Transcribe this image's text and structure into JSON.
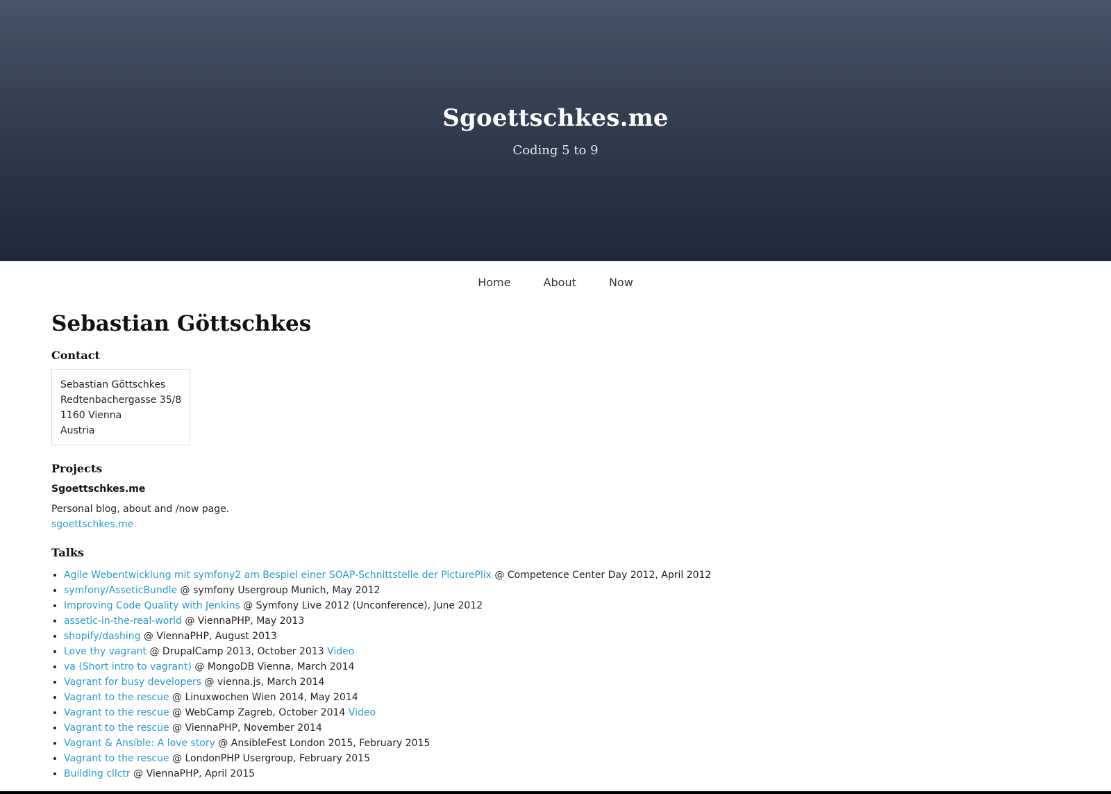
{
  "header": {
    "title": "Sgoettschkes.me",
    "tagline": "Coding 5 to 9"
  },
  "nav": {
    "home": "Home",
    "about": "About",
    "now": "Now"
  },
  "page": {
    "title": "Sebastian Göttschkes"
  },
  "contact": {
    "heading": "Contact",
    "lines": [
      "Sebastian Göttschkes",
      "Redtenbachergasse 35/8",
      "1160 Vienna",
      "Austria"
    ]
  },
  "projects": {
    "heading": "Projects",
    "items": [
      {
        "name": "Sgoettschkes.me",
        "description": "Personal blog, about and /now page.",
        "link": "sgoettschkes.me"
      }
    ]
  },
  "talks": {
    "heading": "Talks",
    "items": [
      {
        "title": "Agile Webentwicklung mit symfony2 am Bespiel einer SOAP-Schnittstelle der PicturePlix",
        "event": " @ Competence Center Day 2012, April 2012",
        "video": ""
      },
      {
        "title": "symfony/AsseticBundle",
        "event": " @ symfony Usergroup Munich, May 2012",
        "video": ""
      },
      {
        "title": "Improving Code Quality with Jenkins",
        "event": " @ Symfony Live 2012 (Unconference), June 2012",
        "video": ""
      },
      {
        "title": "assetic-in-the-real-world",
        "event": " @ ViennaPHP, May 2013",
        "video": ""
      },
      {
        "title": "shopify/dashing",
        "event": " @ ViennaPHP, August 2013",
        "video": ""
      },
      {
        "title": "Love thy vagrant",
        "event": " @ DrupalCamp 2013, October 2013 ",
        "video": "Video"
      },
      {
        "title": "va (Short intro to vagrant)",
        "event": " @ MongoDB Vienna, March 2014",
        "video": ""
      },
      {
        "title": "Vagrant for busy developers",
        "event": " @ vienna.js, March 2014",
        "video": ""
      },
      {
        "title": "Vagrant to the rescue",
        "event": " @ Linuxwochen Wien 2014, May 2014",
        "video": ""
      },
      {
        "title": "Vagrant to the rescue",
        "event": " @ WebCamp Zagreb, October 2014 ",
        "video": "Video"
      },
      {
        "title": "Vagrant to the rescue",
        "event": " @ ViennaPHP, November 2014",
        "video": ""
      },
      {
        "title": "Vagrant & Ansible: A love story",
        "event": " @ AnsibleFest London 2015, February 2015",
        "video": ""
      },
      {
        "title": "Vagrant to the rescue",
        "event": " @ LondonPHP Usergroup, February 2015",
        "video": ""
      },
      {
        "title": "Building cllctr",
        "event": " @ ViennaPHP, April 2015",
        "video": ""
      }
    ]
  },
  "colors": {
    "link": "#2a9ad1",
    "hero_top": "#475467",
    "hero_bottom": "#1f283a"
  }
}
